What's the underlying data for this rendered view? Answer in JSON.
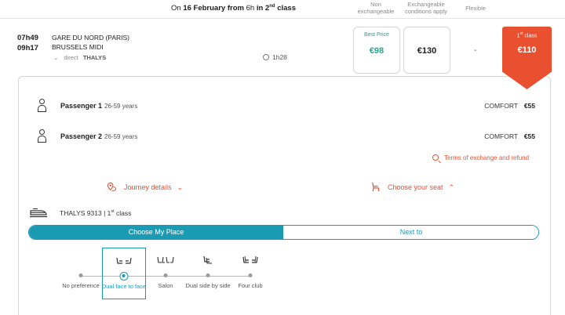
{
  "header": {
    "date_prefix": "On",
    "date": "16 February",
    "from_word": "from",
    "time": "6h",
    "in_word": "in",
    "class_num": "2",
    "class_sup": "nd",
    "class_word": "class"
  },
  "columns": {
    "non_exchangeable": [
      "Non",
      "exchangeable"
    ],
    "exchangeable": [
      "Exchangeable",
      "conditions apply"
    ],
    "flexible": "Flexible"
  },
  "train": {
    "depart_time": "07h49",
    "arrive_time": "09h17",
    "from_station": "GARE DU NORD (PARIS)",
    "to_station": "BRUSSELS MIDI",
    "direct_label": "direct",
    "operator": "THALYS",
    "duration": "1h28"
  },
  "prices": {
    "best_price_label": "Best Price",
    "non_exchangeable": "€98",
    "exchangeable": "€130",
    "flexible": "-",
    "first_class_num": "1",
    "first_class_sup": "st",
    "first_class_word": "class",
    "first_class_price": "€110"
  },
  "passengers": [
    {
      "name": "Passenger 1",
      "age": "26-59 years",
      "fare": "COMFORT",
      "price": "€55"
    },
    {
      "name": "Passenger 2",
      "age": "26-59 years",
      "fare": "COMFORT",
      "price": "€55"
    }
  ],
  "terms_link": "Terms of exchange and refund",
  "journey_details": "Journey details",
  "choose_seat": "Choose your seat",
  "train_info": {
    "name": "THALYS 9313 | 1",
    "sup": "st",
    "word": "class"
  },
  "tabs": {
    "choose": "Choose My Place",
    "next": "Next to"
  },
  "seat_options": [
    {
      "label": "No preference",
      "selected": false
    },
    {
      "label": "Dual face to face",
      "selected": true
    },
    {
      "label": "Salon",
      "selected": false
    },
    {
      "label": "Dual side by side",
      "selected": false
    },
    {
      "label": "Four club",
      "selected": false
    }
  ],
  "colors": {
    "accent": "#e8502f",
    "teal": "#1a9bb3",
    "green": "#27a38b"
  }
}
